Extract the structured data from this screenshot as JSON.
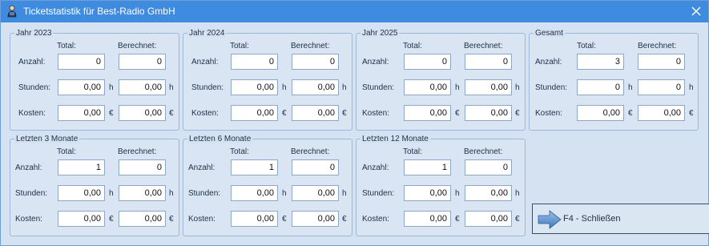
{
  "window": {
    "title": "Ticketstatistik für Best-Radio GmbH"
  },
  "labels": {
    "total": "Total:",
    "berechnet": "Berechnet:",
    "anzahl": "Anzahl:",
    "stunden": "Stunden:",
    "kosten": "Kosten:",
    "unit_hours": "h",
    "unit_currency": "€"
  },
  "groups": {
    "y2023": {
      "title": "Jahr 2023",
      "anzahl_total": "0",
      "anzahl_berechnet": "0",
      "stunden_total": "0,00",
      "stunden_berechnet": "0,00",
      "kosten_total": "0,00",
      "kosten_berechnet": "0,00"
    },
    "y2024": {
      "title": "Jahr 2024",
      "anzahl_total": "0",
      "anzahl_berechnet": "0",
      "stunden_total": "0,00",
      "stunden_berechnet": "0,00",
      "kosten_total": "0,00",
      "kosten_berechnet": "0,00"
    },
    "y2025": {
      "title": "Jahr 2025",
      "anzahl_total": "0",
      "anzahl_berechnet": "0",
      "stunden_total": "0,00",
      "stunden_berechnet": "0,00",
      "kosten_total": "0,00",
      "kosten_berechnet": "0,00"
    },
    "gesamt": {
      "title": "Gesamt",
      "anzahl_total": "3",
      "anzahl_berechnet": "0",
      "stunden_total": "0",
      "stunden_berechnet": "0",
      "kosten_total": "0,00",
      "kosten_berechnet": "0,00"
    },
    "m3": {
      "title": "Letzten 3 Monate",
      "anzahl_total": "1",
      "anzahl_berechnet": "0",
      "stunden_total": "0,00",
      "stunden_berechnet": "0,00",
      "kosten_total": "0,00",
      "kosten_berechnet": "0,00"
    },
    "m6": {
      "title": "Letzten 6 Monate",
      "anzahl_total": "1",
      "anzahl_berechnet": "0",
      "stunden_total": "0,00",
      "stunden_berechnet": "0,00",
      "kosten_total": "0,00",
      "kosten_berechnet": "0,00"
    },
    "m12": {
      "title": "Letzten 12 Monate",
      "anzahl_total": "1",
      "anzahl_berechnet": "0",
      "stunden_total": "0,00",
      "stunden_berechnet": "0,00",
      "kosten_total": "0,00",
      "kosten_berechnet": "0,00"
    }
  },
  "close_button": {
    "label": "F4 - Schließen"
  },
  "icons": {
    "app": "person-icon",
    "close": "close-icon",
    "button": "arrow-right-icon"
  },
  "colors": {
    "titlebar": "#3f8be0",
    "background": "#d5e2f1",
    "arrow": "#5b8fc9"
  }
}
